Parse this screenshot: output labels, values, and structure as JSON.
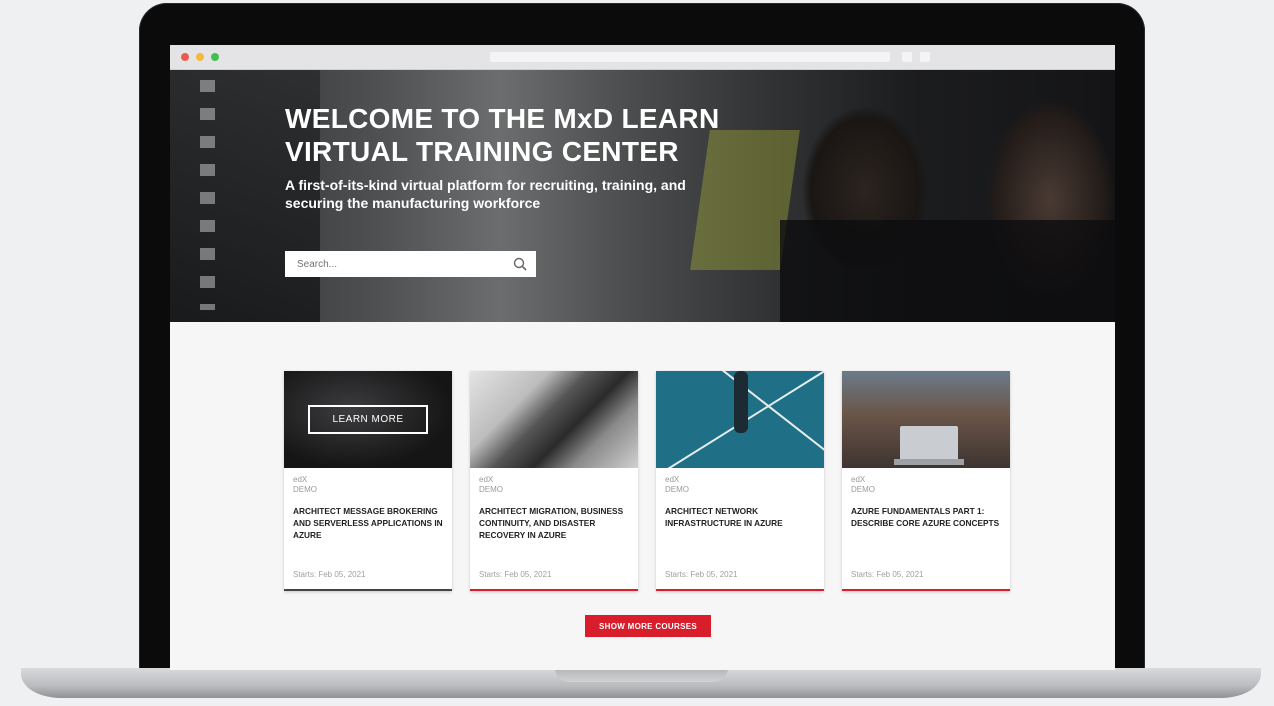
{
  "hero": {
    "title": "WELCOME TO THE MxD LEARN VIRTUAL TRAINING CENTER",
    "subtitle": "A first-of-its-kind virtual platform for recruiting, training, and securing the manufacturing workforce",
    "search_placeholder": "Search..."
  },
  "cards": [
    {
      "provider": "edX",
      "org": "DEMO",
      "title": "ARCHITECT MESSAGE BROKERING AND SERVERLESS APPLICATIONS IN AZURE",
      "starts": "Starts: Feb 05, 2021",
      "hover_button": "LEARN MORE"
    },
    {
      "provider": "edX",
      "org": "DEMO",
      "title": "ARCHITECT MIGRATION, BUSINESS CONTINUITY, AND DISASTER RECOVERY IN AZURE",
      "starts": "Starts: Feb 05, 2021"
    },
    {
      "provider": "edX",
      "org": "DEMO",
      "title": "ARCHITECT NETWORK INFRASTRUCTURE IN AZURE",
      "starts": "Starts: Feb 05, 2021"
    },
    {
      "provider": "edX",
      "org": "DEMO",
      "title": "AZURE FUNDAMENTALS PART 1: DESCRIBE CORE AZURE CONCEPTS",
      "starts": "Starts: Feb 05, 2021"
    }
  ],
  "show_more_label": "SHOW MORE COURSES",
  "colors": {
    "accent": "#d81e2a",
    "page_bg": "#f6f6f7",
    "laptop_frame": "#0b0b0c"
  }
}
